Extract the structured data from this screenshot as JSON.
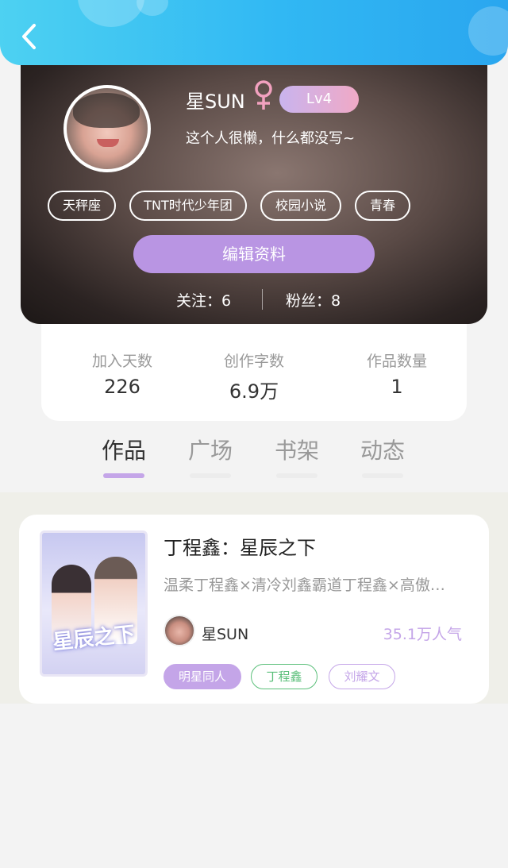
{
  "header": {
    "back_icon": "chevron-left-icon"
  },
  "profile": {
    "username": "星SUN",
    "gender_icon": "female-symbol-icon",
    "gender_color": "#f2a1bf",
    "level": "Lv4",
    "bio": "这个人很懒，什么都没写~",
    "tags": [
      "天秤座",
      "TNT时代少年团",
      "校园小说",
      "青春"
    ],
    "edit_button": "编辑资料",
    "follow": "关注：6",
    "fans": "粉丝：8"
  },
  "stats": [
    {
      "label": "加入天数",
      "value": "226"
    },
    {
      "label": "创作字数",
      "value": "6.9万"
    },
    {
      "label": "作品数量",
      "value": "1"
    }
  ],
  "tabs": [
    {
      "label": "作品",
      "active": true
    },
    {
      "label": "广场",
      "active": false
    },
    {
      "label": "书架",
      "active": false
    },
    {
      "label": "动态",
      "active": false
    }
  ],
  "work": {
    "cover_title": "星辰之下",
    "title": "丁程鑫：星辰之下",
    "description": "温柔丁程鑫×清冷刘鑫霸道丁程鑫×高傲…",
    "author": "星SUN",
    "popularity": "35.1万人气",
    "tags": [
      {
        "label": "明星同人",
        "style": "filled",
        "color": "#c4a5e8"
      },
      {
        "label": "丁程鑫",
        "style": "outline",
        "color": "#5bbf7a"
      },
      {
        "label": "刘耀文",
        "style": "outline",
        "color": "#c4a5e8"
      }
    ]
  },
  "colors": {
    "accent": "#b995e3",
    "header": "#31b8f3",
    "tab_active_bar": "#c4a5e8"
  }
}
